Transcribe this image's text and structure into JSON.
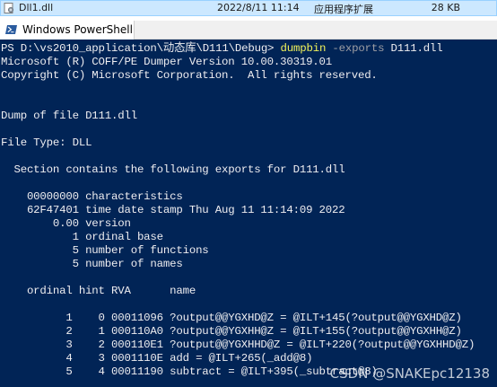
{
  "explorer": {
    "file_name": "Dll1.dll",
    "modified": "2022/8/11 11:14",
    "type": "应用程序扩展",
    "size": "28 KB"
  },
  "window": {
    "tab_title": "Windows PowerShell"
  },
  "console": {
    "prompt": "PS D:\\vs2010_application\\动态库\\D111\\Debug> ",
    "command": "dumpbin",
    "param": " -exports",
    "arg": " D111.dll",
    "lines": [
      "Microsoft (R) COFF/PE Dumper Version 10.00.30319.01",
      "Copyright (C) Microsoft Corporation.  All rights reserved.",
      "",
      "",
      "Dump of file D111.dll",
      "",
      "File Type: DLL",
      "",
      "  Section contains the following exports for D111.dll",
      "",
      "    00000000 characteristics",
      "    62F47401 time date stamp Thu Aug 11 11:14:09 2022",
      "        0.00 version",
      "           1 ordinal base",
      "           5 number of functions",
      "           5 number of names",
      "",
      "    ordinal hint RVA      name",
      "",
      "          1    0 00011096 ?output@@YGXHD@Z = @ILT+145(?output@@YGXHD@Z)",
      "          2    1 000110A0 ?output@@YGXHH@Z = @ILT+155(?output@@YGXHH@Z)",
      "          3    2 000110E1 ?output@@YGXHHD@Z = @ILT+220(?output@@YGXHHD@Z)",
      "          4    3 0001110E add = @ILT+265(_add@8)",
      "          5    4 00011190 subtract = @ILT+395(_subtract@8)"
    ]
  },
  "watermark": "CSDN @SNAKEpc12138",
  "colors": {
    "console_bg": "#012456",
    "console_fg": "#eeedf0",
    "command": "#f2f25a",
    "parameter": "#9e9ea4",
    "selection_bg": "#cce8ff"
  }
}
